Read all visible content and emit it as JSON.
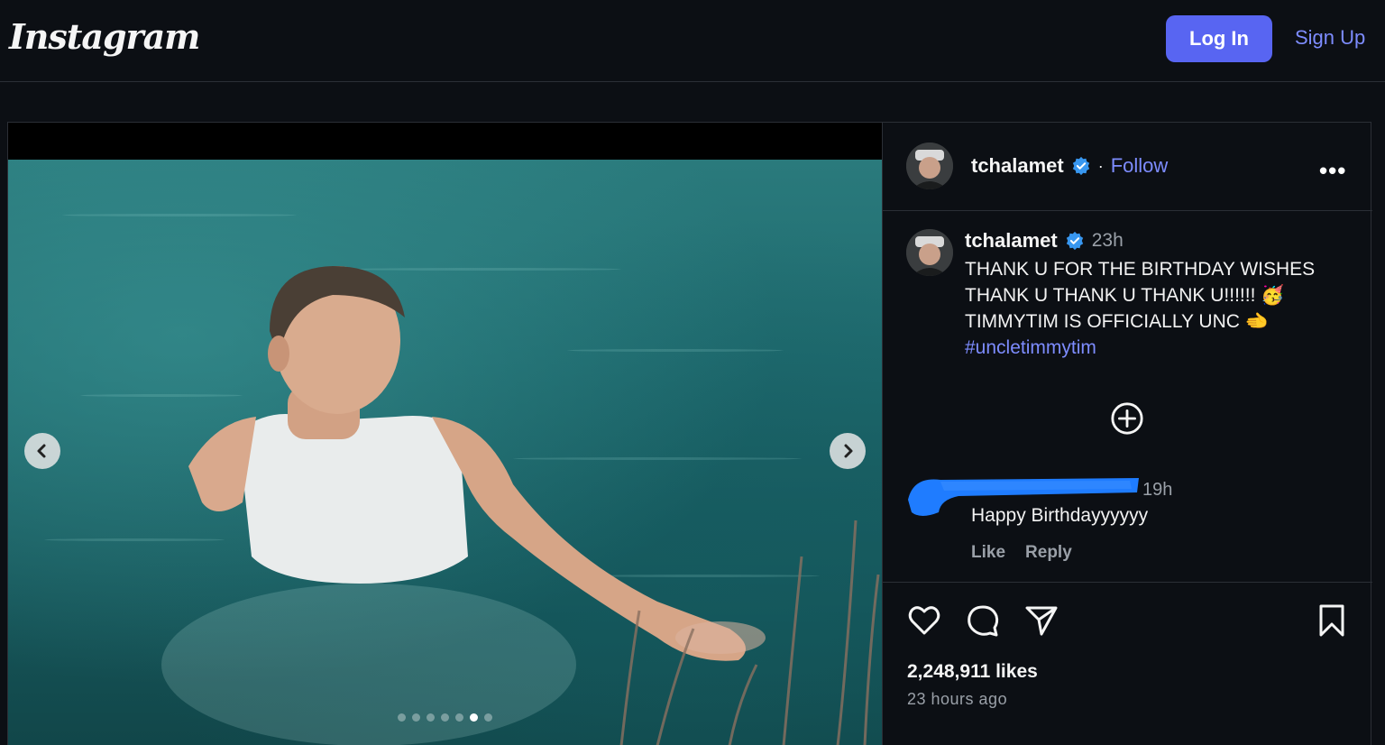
{
  "header": {
    "logo": "Instagram",
    "login_label": "Log In",
    "signup_label": "Sign Up"
  },
  "post": {
    "username": "tchalamet",
    "follow_label": "Follow",
    "more_label": "•••",
    "carousel": {
      "count": 7,
      "active_index": 5
    },
    "caption": {
      "username": "tchalamet",
      "time": "23h",
      "line1": "THANK U FOR THE BIRTHDAY WISHES",
      "line2": "THANK U THANK U THANK U!!!!!! 🥳",
      "line3": "TIMMYTIM IS OFFICIALLY UNC 🫲",
      "hashtag": "#uncletimmytim"
    },
    "comment": {
      "time": "19h",
      "text": "Happy Birthdayyyyyy",
      "like_label": "Like",
      "reply_label": "Reply"
    },
    "likes": "2,248,911 likes",
    "time_ago": "23 hours ago"
  },
  "colors": {
    "accent": "#5865f2",
    "link": "#7d8cff",
    "verified": "#3897f0",
    "redaction": "#1f7cff"
  },
  "icons": [
    "chevron-left-icon",
    "chevron-right-icon",
    "verified-icon",
    "plus-circle-icon",
    "heart-icon",
    "comment-icon",
    "share-icon",
    "bookmark-icon"
  ]
}
